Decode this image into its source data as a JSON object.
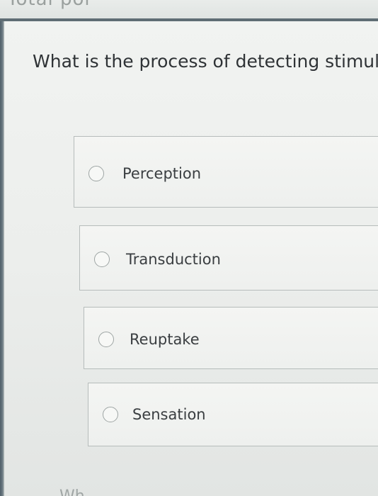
{
  "header": {
    "partial_text": "Total poi"
  },
  "question": {
    "text": "What is the process of detecting stimuli?"
  },
  "options": [
    {
      "label": "Perception"
    },
    {
      "label": "Transduction"
    },
    {
      "label": "Reuptake"
    },
    {
      "label": "Sensation"
    }
  ],
  "next_question": {
    "partial_text": "Wh"
  }
}
